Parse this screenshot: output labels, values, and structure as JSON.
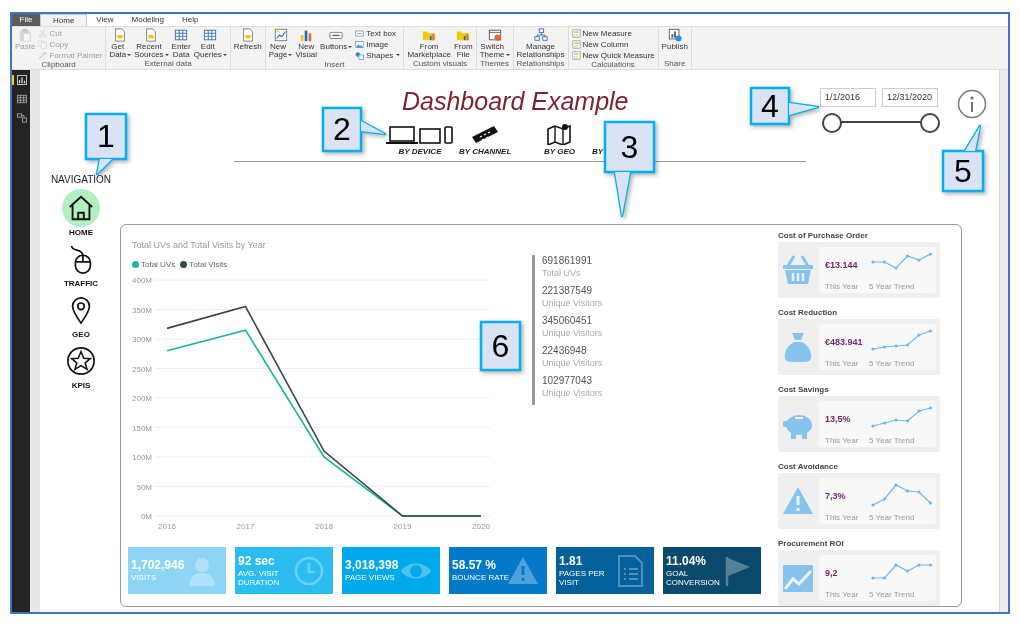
{
  "ribbon": {
    "tabs": [
      {
        "label": "File",
        "kind": "file",
        "selected": false
      },
      {
        "label": "Home",
        "kind": "tab",
        "selected": true
      },
      {
        "label": "View",
        "kind": "tab",
        "selected": false
      },
      {
        "label": "Modeling",
        "kind": "tab",
        "selected": false
      },
      {
        "label": "Help",
        "kind": "tab",
        "selected": false
      }
    ],
    "groups": [
      {
        "label": "Clipboard",
        "buttons": [
          {
            "label": "Paste",
            "dropdown": false,
            "disabled": true
          }
        ],
        "small_buttons": [
          {
            "label": "Cut",
            "dropdown": false,
            "disabled": true
          },
          {
            "label": "Copy",
            "dropdown": false,
            "disabled": true
          },
          {
            "label": "Format Painter",
            "dropdown": false,
            "disabled": true
          }
        ]
      },
      {
        "label": "External data",
        "buttons": [
          {
            "label": "Get Data",
            "dropdown": true,
            "disabled": false
          },
          {
            "label": "Recent Sources",
            "dropdown": true,
            "disabled": false
          },
          {
            "label": "Enter Data",
            "dropdown": false,
            "disabled": false
          },
          {
            "label": "Edit Queries",
            "dropdown": true,
            "disabled": false
          }
        ]
      },
      {
        "buttons": [
          {
            "label": "Refresh",
            "dropdown": false,
            "disabled": false
          }
        ]
      },
      {
        "label": "Insert",
        "buttons": [
          {
            "label": "New Page",
            "dropdown": true,
            "disabled": false
          },
          {
            "label": "New Visual",
            "dropdown": false,
            "disabled": false
          },
          {
            "label": "Buttons",
            "dropdown": true,
            "disabled": false
          }
        ],
        "small_buttons": [
          {
            "label": "Text box",
            "dropdown": false,
            "disabled": false
          },
          {
            "label": "Image",
            "dropdown": false,
            "disabled": false
          },
          {
            "label": "Shapes",
            "dropdown": true,
            "disabled": false
          }
        ]
      },
      {
        "label": "Custom visuals",
        "buttons": [
          {
            "label": "From Marketplace",
            "dropdown": false,
            "disabled": false
          },
          {
            "label": "From File",
            "dropdown": false,
            "disabled": false
          }
        ]
      },
      {
        "label": "Themes",
        "buttons": [
          {
            "label": "Switch Theme",
            "dropdown": true,
            "disabled": false
          }
        ]
      },
      {
        "label": "Relationships",
        "buttons": [
          {
            "label": "Manage Relationships",
            "dropdown": false,
            "disabled": false
          }
        ]
      },
      {
        "label": "Calculations",
        "small_buttons": [
          {
            "label": "New Measure",
            "dropdown": false,
            "disabled": false
          },
          {
            "label": "New Column",
            "dropdown": false,
            "disabled": false
          },
          {
            "label": "New Quick Measure",
            "dropdown": false,
            "disabled": false
          }
        ]
      },
      {
        "label": "Share",
        "buttons": [
          {
            "label": "Publish",
            "dropdown": false,
            "disabled": false
          }
        ]
      }
    ]
  },
  "view_switcher": [
    {
      "selected": true
    },
    {
      "selected": false
    },
    {
      "selected": false
    }
  ],
  "report": {
    "title": "Dashboard Example",
    "categories": [
      {
        "label": "BY DEVICE"
      },
      {
        "label": "BY CHANNEL"
      },
      {
        "label": "BY GEO"
      },
      {
        "label": "BY"
      }
    ],
    "date_range": {
      "start": "1/1/2016",
      "end": "12/31/2020"
    },
    "navigation": {
      "title": "NAVIGATION",
      "items": [
        {
          "label": "HOME",
          "selected": true
        },
        {
          "label": "TRAFFIC",
          "selected": false
        },
        {
          "label": "GEO",
          "selected": false
        },
        {
          "label": "KPIS",
          "selected": false
        }
      ]
    },
    "line_chart": {
      "chart_data": {
        "type": "line",
        "grid": true,
        "title": "Total UVs and Total Visits by Year",
        "categories": [
          "2016",
          "2017",
          "2018",
          "2019",
          "2020"
        ],
        "series": [
          {
            "name": "Total UVs",
            "color": "#1ab5a0",
            "values": [
              280,
              315,
              100,
              0,
              0
            ]
          },
          {
            "name": "Total Visits",
            "color": "#374649",
            "values": [
              318,
              355,
              110,
              0,
              0
            ]
          }
        ],
        "ylim": [
          0,
          400
        ],
        "yticks": [
          {
            "value": 0,
            "label": "0M"
          },
          {
            "value": 50,
            "label": "50M"
          },
          {
            "value": 100,
            "label": "100M"
          },
          {
            "value": 150,
            "label": "150M"
          },
          {
            "value": 200,
            "label": "200M"
          },
          {
            "value": 250,
            "label": "250M"
          },
          {
            "value": 300,
            "label": "300M"
          },
          {
            "value": 350,
            "label": "350M"
          },
          {
            "value": 400,
            "label": "400M"
          }
        ]
      }
    },
    "stats": [
      {
        "value": "691861991",
        "label": "Total UVs"
      },
      {
        "value": "221387549",
        "label": "Unique Visitors"
      },
      {
        "value": "345060451",
        "label": "Unique Visitors"
      },
      {
        "value": "22436948",
        "label": "Unique Visitors"
      },
      {
        "value": "102977043",
        "label": "Unique Visitors"
      }
    ],
    "tiles": [
      {
        "value": "1,702,946",
        "label": "VISITS",
        "color": "#8ed5f5"
      },
      {
        "value": "92 sec",
        "label": "AVG. VISIT DURATION",
        "color": "#2bbdf0"
      },
      {
        "value": "3,018,398",
        "label": "PAGE VIEWS",
        "color": "#00a8ec"
      },
      {
        "value": "58.57 %",
        "label": "BOUNCE RATE",
        "color": "#0479c9"
      },
      {
        "value": "1.81",
        "label": "PAGES PER VISIT",
        "color": "#03609a"
      },
      {
        "value": "11.04%",
        "label": "GOAL CONVERSION",
        "color": "#0b4a6c"
      }
    ],
    "kpi_cards": [
      {
        "title": "Cost of Purchase Order",
        "value": "€13.144",
        "this_year": "This Year",
        "trend": "5 Year Trend"
      },
      {
        "title": "Cost Reduction",
        "value": "€483.941",
        "this_year": "This Year",
        "trend": "5 Year Trend"
      },
      {
        "title": "Cost Savings",
        "value": "13,5%",
        "this_year": "This Year",
        "trend": "5 Year Trend"
      },
      {
        "title": "Cost Avoidance",
        "value": "7,3%",
        "this_year": "This Year",
        "trend": "5 Year Trend"
      },
      {
        "title": "Procurement ROI",
        "value": "9,2",
        "this_year": "This Year",
        "trend": "5 Year Trend"
      }
    ]
  },
  "callouts": [
    {
      "number": "1"
    },
    {
      "number": "2"
    },
    {
      "number": "3"
    },
    {
      "number": "4"
    },
    {
      "number": "5"
    },
    {
      "number": "6"
    }
  ]
}
